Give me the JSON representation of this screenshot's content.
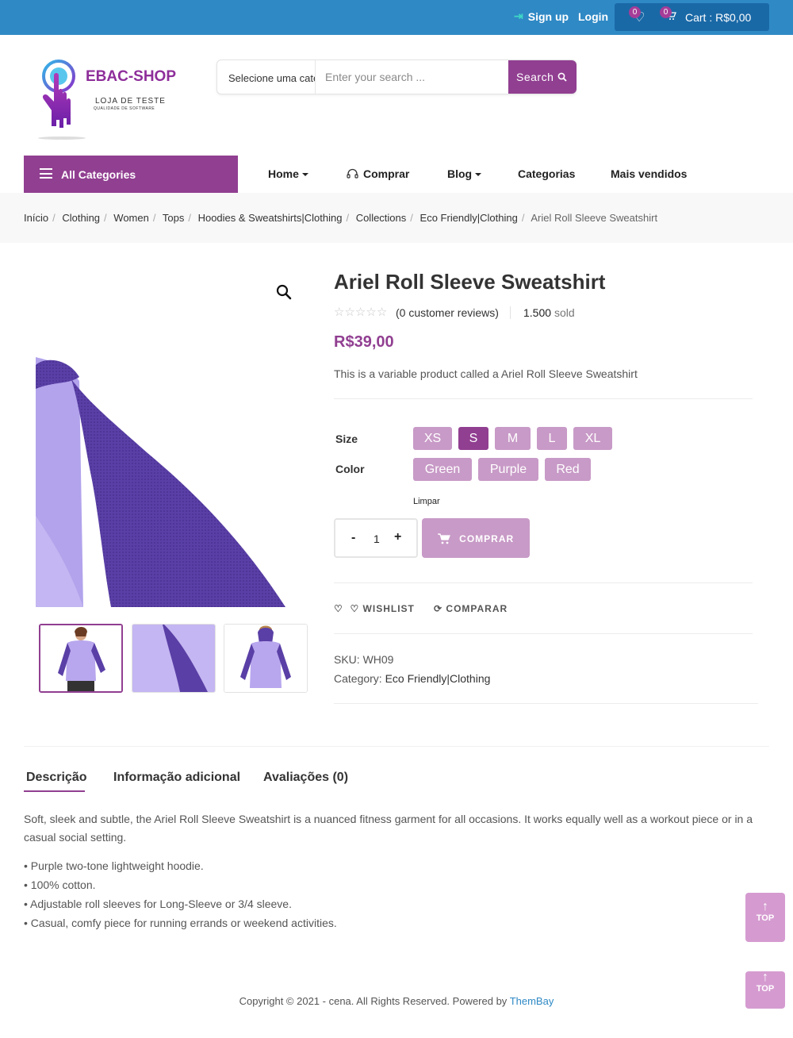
{
  "topbar": {
    "signup": "Sign up",
    "login": "Login",
    "wishlist_count": "0",
    "cart_count": "0",
    "cart_label": "Cart : R$0,00"
  },
  "logo": {
    "brand": "EBAC-SHOP",
    "tagline": "LOJA DE TESTE",
    "subtagline": "QUALIDADE DE SOFTWARE"
  },
  "search": {
    "category": "Selecione uma categoria",
    "placeholder": "Enter your search ...",
    "button": "Search"
  },
  "nav": {
    "all_categories": "All Categories",
    "items": [
      "Home",
      "Comprar",
      "Blog",
      "Categorias",
      "Mais vendidos"
    ]
  },
  "breadcrumb": [
    "Início",
    "Clothing",
    "Women",
    "Tops",
    "Hoodies & Sweatshirts|Clothing",
    "Collections",
    "Eco Friendly|Clothing",
    "Ariel Roll Sleeve Sweatshirt"
  ],
  "product": {
    "title": "Ariel Roll Sleeve Sweatshirt",
    "reviews": "(0 customer reviews)",
    "sold_count": "1.500",
    "sold_label": "sold",
    "price": "R$39,00",
    "short_description": "This is a variable product called a Ariel Roll Sleeve Sweatshirt",
    "size_label": "Size",
    "sizes": [
      "XS",
      "S",
      "M",
      "L",
      "XL"
    ],
    "selected_size": "S",
    "color_label": "Color",
    "colors": [
      "Green",
      "Purple",
      "Red"
    ],
    "clear": "Limpar",
    "quantity": "1",
    "buy_button": "COMPRAR",
    "wishlist": "WISHLIST",
    "compare": "COMPARAR",
    "sku": "SKU: WH09",
    "category_label": "Category:",
    "category": "Eco Friendly|Clothing",
    "rating": 0,
    "rating_max": 5
  },
  "tabs": [
    "Descrição",
    "Informação adicional",
    "Avaliações (0)"
  ],
  "description": {
    "text": "Soft, sleek and subtle, the Ariel Roll Sleeve Sweatshirt is a nuanced fitness garment for all occasions. It works equally well as a workout piece or in a casual social setting.",
    "bullets": [
      "• Purple two-tone lightweight hoodie.",
      "• 100% cotton.",
      "• Adjustable roll sleeves for Long-Sleeve or 3/4 sleeve.",
      "• Casual, comfy piece for running errands or weekend activities."
    ]
  },
  "totop": "TOP",
  "footer": {
    "text": "Copyright © 2021 - cena. All Rights Reserved. Powered by ",
    "link": "ThemBay"
  },
  "colors": {
    "topbar": "#2f89c5",
    "accent": "#913f91",
    "swatch": "#c89ac7"
  }
}
